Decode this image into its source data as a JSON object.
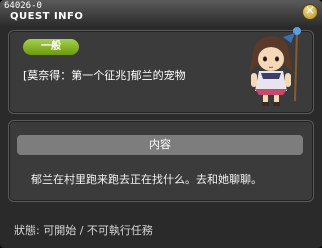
{
  "window": {
    "quest_id": "64026-0",
    "title": "QUEST INFO"
  },
  "quest": {
    "category": "一般",
    "name": "[莫奈得：第一个征兆]郁兰的宠物",
    "content_header": "内容",
    "content_text": "郁兰在村里跑来跑去正在找什么。去和她聊聊。",
    "status": "狀態: 可開始 / 不可執行任務"
  },
  "colors": {
    "badge_green": "#8dbb2c",
    "panel": "#3b3b3b",
    "header_gray": "#7d7d7d"
  },
  "icons": {
    "close": "close-icon",
    "npc": "npc-portrait"
  }
}
